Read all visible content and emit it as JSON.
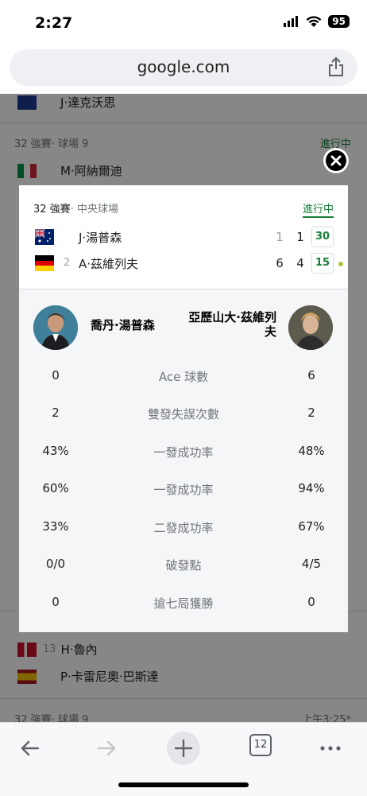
{
  "status_bar": {
    "time": "2:27",
    "battery": "95"
  },
  "browser": {
    "url": "google.com",
    "tab_count": "12"
  },
  "background": {
    "partial_player": "J·達克沃思",
    "sections": [
      {
        "round": "32 強賽",
        "venue": "· 球場 9",
        "status": "進行中",
        "players": [
          {
            "name": "M·阿納爾迪"
          }
        ]
      },
      {
        "round": "32 強賽",
        "venue": "· 球場 9",
        "status": "上午3:25*",
        "players": [
          {
            "seed": "13",
            "name": "H·魯內"
          },
          {
            "name": "P·卡雷尼奧·巴斯達"
          }
        ]
      }
    ]
  },
  "match": {
    "round": "32 強賽",
    "venue": "· 中央球場",
    "status": "進行中",
    "players": [
      {
        "seed": "",
        "name": "J·湯普森",
        "set1": "1",
        "set2": "1",
        "points": "30",
        "flag": "australia",
        "serving": false
      },
      {
        "seed": "2",
        "name": "A·茲維列夫",
        "set1": "6",
        "set2": "4",
        "points": "15",
        "flag": "germany",
        "serving": true
      }
    ]
  },
  "stats": {
    "player1_full_name": "喬丹·湯普森",
    "player2_full_name": "亞歷山大·茲維列夫",
    "rows": [
      {
        "label": "Ace 球數",
        "p1": "0",
        "p2": "6"
      },
      {
        "label": "雙發失誤次數",
        "p1": "2",
        "p2": "2"
      },
      {
        "label": "一發成功率",
        "p1": "43%",
        "p2": "48%"
      },
      {
        "label": "一發成功率",
        "p1": "60%",
        "p2": "94%"
      },
      {
        "label": "二發成功率",
        "p1": "33%",
        "p2": "67%"
      },
      {
        "label": "破發點",
        "p1": "0/0",
        "p2": "4/5"
      },
      {
        "label": "搶七局獲勝",
        "p1": "0",
        "p2": "0"
      }
    ]
  },
  "colors": {
    "accent_green": "#188038",
    "serve_dot": "#a8c83a"
  },
  "icons": [
    "share-icon",
    "close-icon",
    "back-icon",
    "forward-icon",
    "new-tab-icon",
    "tabs-icon",
    "more-icon"
  ]
}
